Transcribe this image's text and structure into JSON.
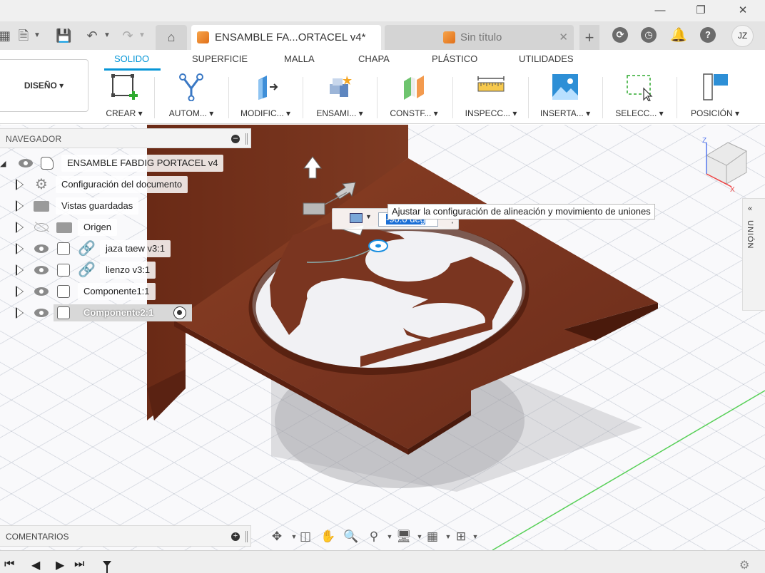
{
  "window": {
    "minimize_icon": "minimize-icon",
    "maximize_icon": "restore-icon",
    "close_icon": "close-icon"
  },
  "tabs": [
    {
      "label": "ENSAMBLE FA...ORTACEL v4*",
      "active": true
    },
    {
      "label": "Sin título",
      "active": false
    }
  ],
  "user": {
    "initials": "JZ"
  },
  "ribbon": {
    "design_label": "DISEÑO",
    "tabs": [
      "SOLIDO",
      "SUPERFICIE",
      "MALLA",
      "CHAPA",
      "PLÁSTICO",
      "UTILIDADES"
    ],
    "active_tab": "SOLIDO",
    "tools": [
      {
        "label": "CREAR",
        "icon": "create-sketch-icon"
      },
      {
        "label": "AUTOM...",
        "icon": "automate-icon"
      },
      {
        "label": "MODIFIC...",
        "icon": "modify-icon"
      },
      {
        "label": "ENSAMI...",
        "icon": "assemble-icon"
      },
      {
        "label": "CONSTF...",
        "icon": "construct-icon"
      },
      {
        "label": "INSPECC...",
        "icon": "inspect-icon"
      },
      {
        "label": "INSERTA...",
        "icon": "insert-image-icon"
      },
      {
        "label": "SELECC...",
        "icon": "select-icon"
      },
      {
        "label": "POSICIÓN",
        "icon": "position-icon"
      }
    ]
  },
  "navigator": {
    "title": "NAVEGADOR",
    "items": [
      {
        "label": "ENSAMBLE FABDIG PORTACEL v4",
        "level": 0
      },
      {
        "label": "Configuración del documento",
        "level": 1
      },
      {
        "label": "Vistas guardadas",
        "level": 1
      },
      {
        "label": "Origen",
        "level": 1
      },
      {
        "label": "jaza taew v3:1",
        "level": 1
      },
      {
        "label": "lienzo v3:1",
        "level": 1
      },
      {
        "label": "Componente1:1",
        "level": 1
      },
      {
        "label": "Componente2:1",
        "level": 1,
        "selected": true
      }
    ]
  },
  "manipulator": {
    "angle_value": "-90.0 deg",
    "tooltip": "Ajustar la configuración de alineación y movimiento de uniones"
  },
  "side_panel": {
    "label": "UNIÓN"
  },
  "viewcube": {
    "x_label": "X",
    "z_label": "Z"
  },
  "comments": {
    "title": "COMENTARIOS"
  },
  "colors": {
    "accent": "#0696d7",
    "wood": "#7a3520",
    "grid_axis": "#58d058"
  }
}
